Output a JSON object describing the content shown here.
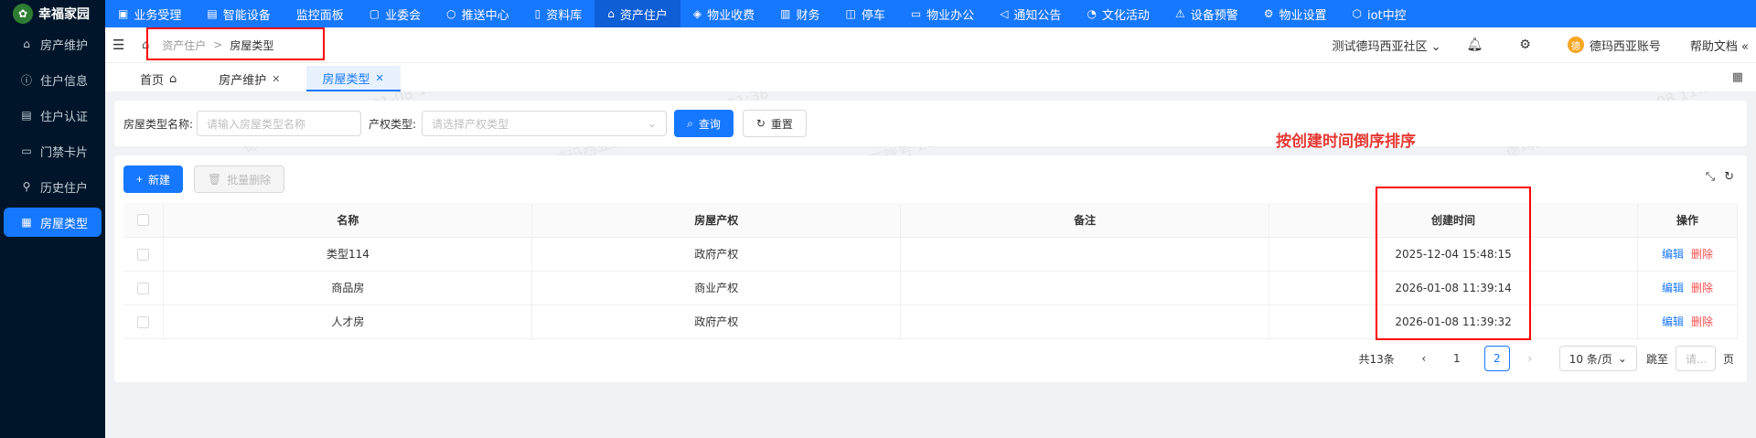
{
  "app": {
    "name": "幸福家园"
  },
  "sidebar": {
    "items": [
      {
        "label": "房产维护",
        "icon": "home-icon"
      },
      {
        "label": "住户信息",
        "icon": "info-icon"
      },
      {
        "label": "住户认证",
        "icon": "certificate-icon"
      },
      {
        "label": "门禁卡片",
        "icon": "card-icon"
      },
      {
        "label": "历史住户",
        "icon": "history-icon"
      },
      {
        "label": "房屋类型",
        "icon": "building-type-icon",
        "active": true
      }
    ]
  },
  "topnav": {
    "items": [
      {
        "label": "业务受理",
        "icon": "business-icon"
      },
      {
        "label": "智能设备",
        "icon": "device-icon"
      },
      {
        "label": "监控面板",
        "icon": ""
      },
      {
        "label": "业委会",
        "icon": "committee-icon"
      },
      {
        "label": "推送中心",
        "icon": "push-icon"
      },
      {
        "label": "资料库",
        "icon": "library-icon"
      },
      {
        "label": "资产住户",
        "icon": "home-icon",
        "active": true
      },
      {
        "label": "物业收费",
        "icon": "fee-icon"
      },
      {
        "label": "财务",
        "icon": "finance-icon"
      },
      {
        "label": "停车",
        "icon": "car-icon"
      },
      {
        "label": "物业办公",
        "icon": "office-icon"
      },
      {
        "label": "通知公告",
        "icon": "notice-icon"
      },
      {
        "label": "文化活动",
        "icon": "activity-icon"
      },
      {
        "label": "设备预警",
        "icon": "alarm-icon"
      },
      {
        "label": "物业设置",
        "icon": "settings-icon"
      },
      {
        "label": "iot中控",
        "icon": "iot-icon"
      }
    ]
  },
  "header": {
    "breadcrumb": {
      "parent": "资产住户",
      "separator": ">",
      "current": "房屋类型"
    },
    "community": "测试德玛西亚社区",
    "user": "德玛西亚账号",
    "help": "帮助文档"
  },
  "tabs": [
    {
      "label": "首页"
    },
    {
      "label": "房产维护"
    },
    {
      "label": "房屋类型",
      "active": true
    }
  ],
  "search": {
    "name_label": "房屋类型名称:",
    "name_placeholder": "请输入房屋类型名称",
    "right_label": "产权类型:",
    "right_placeholder": "请选择产权类型",
    "query_button": "查询",
    "reset_button": "重置"
  },
  "annotation": "按创建时间倒序排序",
  "toolbar": {
    "new_button": "新建",
    "batch_delete_button": "批量删除"
  },
  "table": {
    "columns": [
      "名称",
      "房屋产权",
      "备注",
      "创建时间",
      "操作"
    ],
    "rows": [
      {
        "name": "类型114",
        "right": "政府产权",
        "remark": "",
        "created": "2025-12-04 15:48:15"
      },
      {
        "name": "商品房",
        "right": "商业产权",
        "remark": "",
        "created": "2026-01-08 11:39:14"
      },
      {
        "name": "人才房",
        "right": "政府产权",
        "remark": "",
        "created": "2026-01-08 11:39:32"
      }
    ],
    "edit_label": "编辑",
    "delete_label": "删除"
  },
  "pagination": {
    "total": "共13条",
    "pages": [
      "1",
      "2"
    ],
    "current_page": "2",
    "page_size": "10 条/页",
    "jump_label": "跳至",
    "jump_placeholder": "请...",
    "page_suffix": "页"
  },
  "watermark": "德玛西亚账号 2026-01-08 11:38",
  "colors": {
    "primary": "#1677ff",
    "sidebar_bg": "#001529",
    "highlight_box": "#ff0000",
    "annotation": "#e53935"
  }
}
